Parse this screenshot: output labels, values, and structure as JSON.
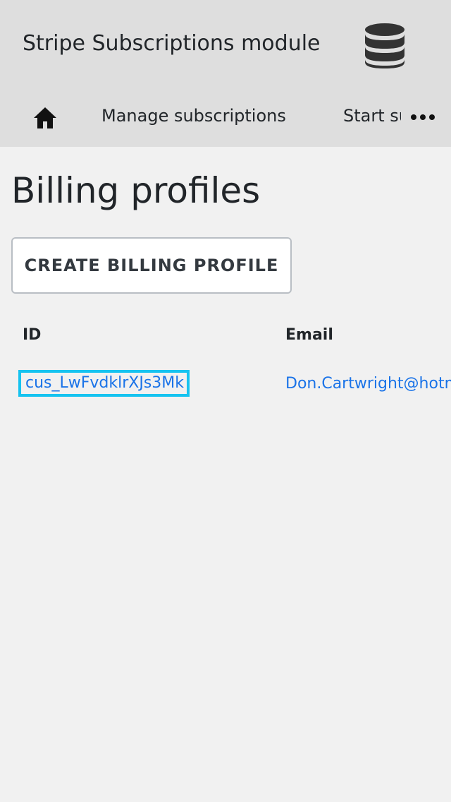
{
  "header": {
    "app_title": "Stripe Subscriptions module"
  },
  "nav": {
    "home_icon": "home-icon",
    "items": [
      {
        "label": "Manage subscriptions"
      },
      {
        "label": "Start subscription"
      }
    ],
    "more_icon": "ellipsis-icon"
  },
  "page": {
    "title": "Billing profiles",
    "create_button_label": "CREATE BILLING PROFILE"
  },
  "table": {
    "columns": [
      "ID",
      "Email"
    ],
    "rows": [
      {
        "id": "cus_LwFvdklrXJs3Mk",
        "email": "Don.Cartwright@hotmail.com"
      }
    ]
  },
  "colors": {
    "header_bg": "#dedede",
    "page_bg": "#f1f1f1",
    "link": "#1a73e8",
    "focus_outline": "#16c3f0"
  }
}
